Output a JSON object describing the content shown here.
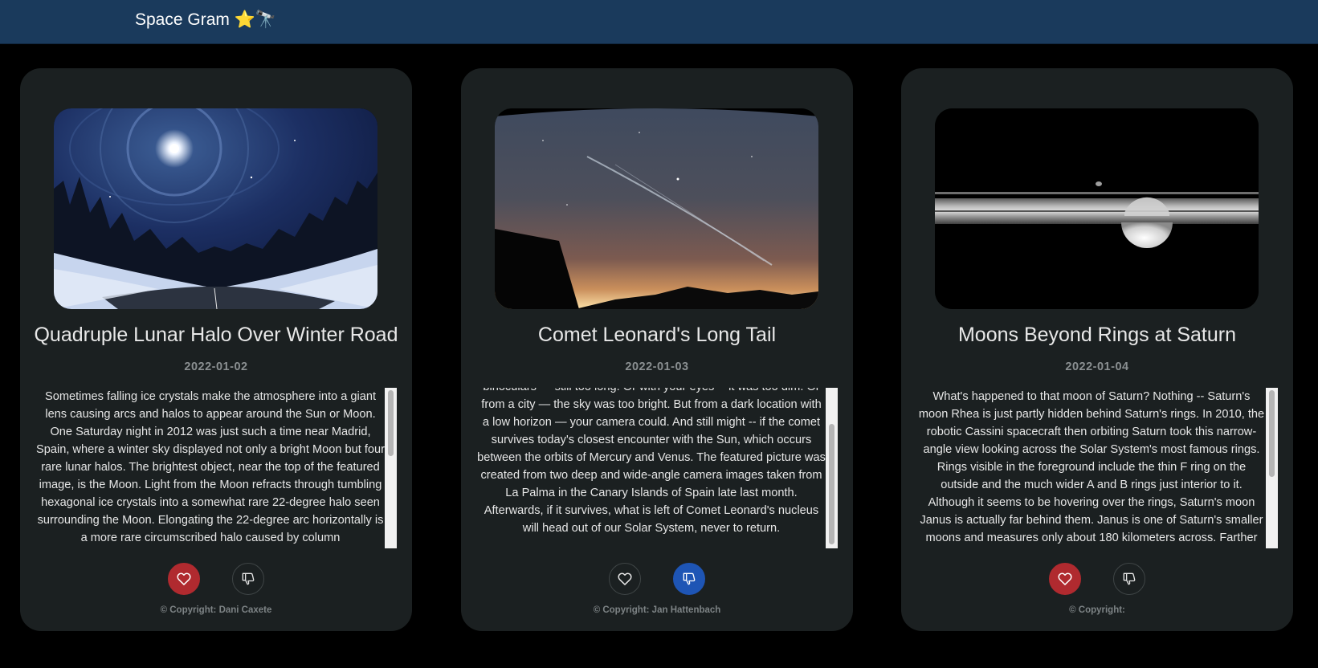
{
  "app": {
    "brand": "Space Gram ⭐🔭"
  },
  "colors": {
    "navbar": "#1a3a5c",
    "card": "#1b2021",
    "like_active": "#b02a2f",
    "dislike_active": "#1e55b5"
  },
  "posts": [
    {
      "title": "Quadruple Lunar Halo Over Winter Road",
      "date": "2022-01-02",
      "explanation": "Sometimes falling ice crystals make the atmosphere into a giant lens causing arcs and halos to appear around the Sun or Moon. One Saturday night in 2012 was just such a time near Madrid, Spain, where a winter sky displayed not only a bright Moon but four rare lunar halos. The brightest object, near the top of the featured image, is the Moon. Light from the Moon refracts through tumbling hexagonal ice crystals into a somewhat rare 22-degree halo seen surrounding the Moon. Elongating the 22-degree arc horizontally is a more rare circumscribed halo caused by column",
      "copyright": "© Copyright: Dani Caxete",
      "liked": true,
      "disliked": false,
      "image_icon": "moon-halo-photo"
    },
    {
      "title": "Comet Leonard's Long Tail",
      "date": "2022-01-03",
      "explanation": "binoculars — still too long. Or with your eyes -- it was too dim. Or from a city — the sky was too bright. But from a dark location with a low horizon — your camera could. And still might -- if the comet survives today's closest encounter with the Sun, which occurs between the orbits of Mercury and Venus. The featured picture was created from two deep and wide-angle camera images taken from La Palma in the Canary Islands of Spain late last month. Afterwards, if it survives, what is left of Comet Leonard's nucleus will head out of our Solar System, never to return.",
      "copyright": "© Copyright: Jan Hattenbach",
      "liked": false,
      "disliked": true,
      "image_icon": "comet-tail-photo"
    },
    {
      "title": "Moons Beyond Rings at Saturn",
      "date": "2022-01-04",
      "explanation": "What's happened to that moon of Saturn? Nothing -- Saturn's moon Rhea is just partly hidden behind Saturn's rings. In 2010, the robotic Cassini spacecraft then orbiting Saturn took this narrow-angle view looking across the Solar System's most famous rings. Rings visible in the foreground include the thin F ring on the outside and the much wider A and B rings just interior to it. Although it seems to be hovering over the rings, Saturn's moon Janus is actually far behind them. Janus is one of Saturn's smaller moons and measures only about 180 kilometers across. Farther",
      "copyright": "© Copyright:",
      "liked": true,
      "disliked": false,
      "image_icon": "saturn-rings-photo"
    }
  ]
}
